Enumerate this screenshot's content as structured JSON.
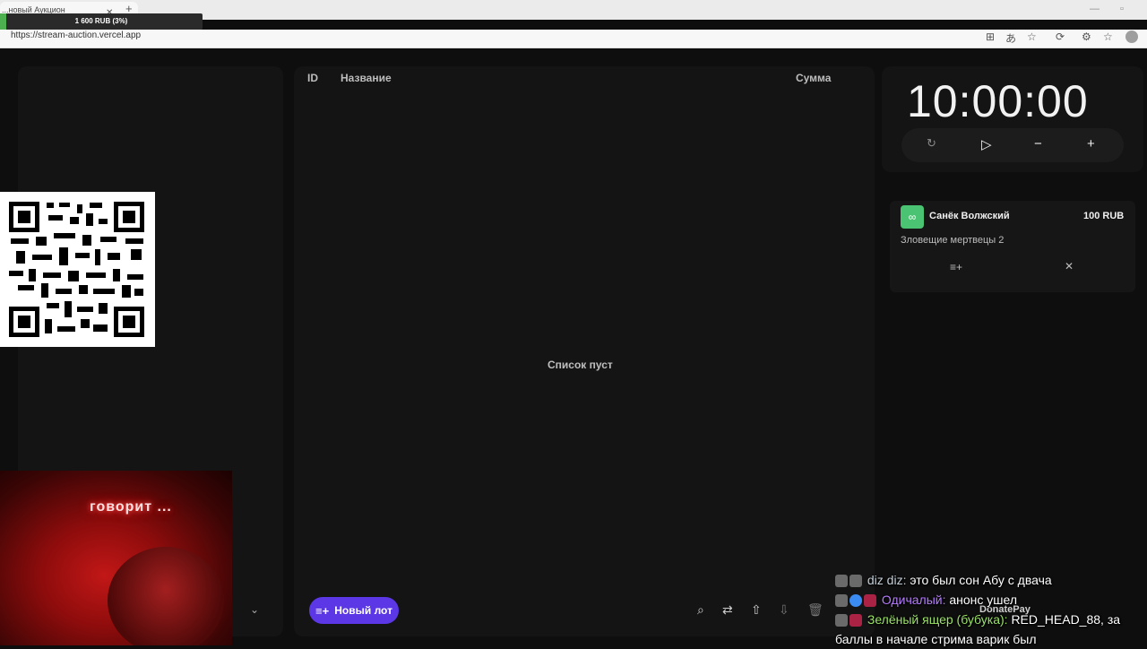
{
  "browser": {
    "tab_title": "...новый Аукцион",
    "url": "https://stream-auction.vercel.app"
  },
  "overlay": {
    "goal_text": "1 600 RUB (3%)",
    "goal_progress": 0.03
  },
  "table": {
    "col_id": "ID",
    "col_name": "Название",
    "col_sum": "Сумма",
    "empty_text": "Список пуст"
  },
  "toolbar": {
    "new_lot_label": "Новый лот"
  },
  "timer": {
    "value": "10:00:00"
  },
  "donation": {
    "name": "Санёк Волжский",
    "amount": "100 RUB",
    "message": "Зловещие мертвецы 2"
  },
  "webcam": {
    "neon_text": "говорит ..."
  },
  "chat": [
    {
      "user": "diz diz:",
      "text": "это был сон Абу с двача"
    },
    {
      "user": "Одичалый:",
      "text": "анонс ушел"
    },
    {
      "user": "Зелёный ящер (бубука):",
      "text": "RED_HEAD_88, за баллы в начале стрима варик был"
    }
  ],
  "donatepay_label": "DonatePay",
  "colors": {
    "accent": "#5b37e6",
    "donation_icon": "#4ac472",
    "goal_fill": "#4caf50"
  }
}
